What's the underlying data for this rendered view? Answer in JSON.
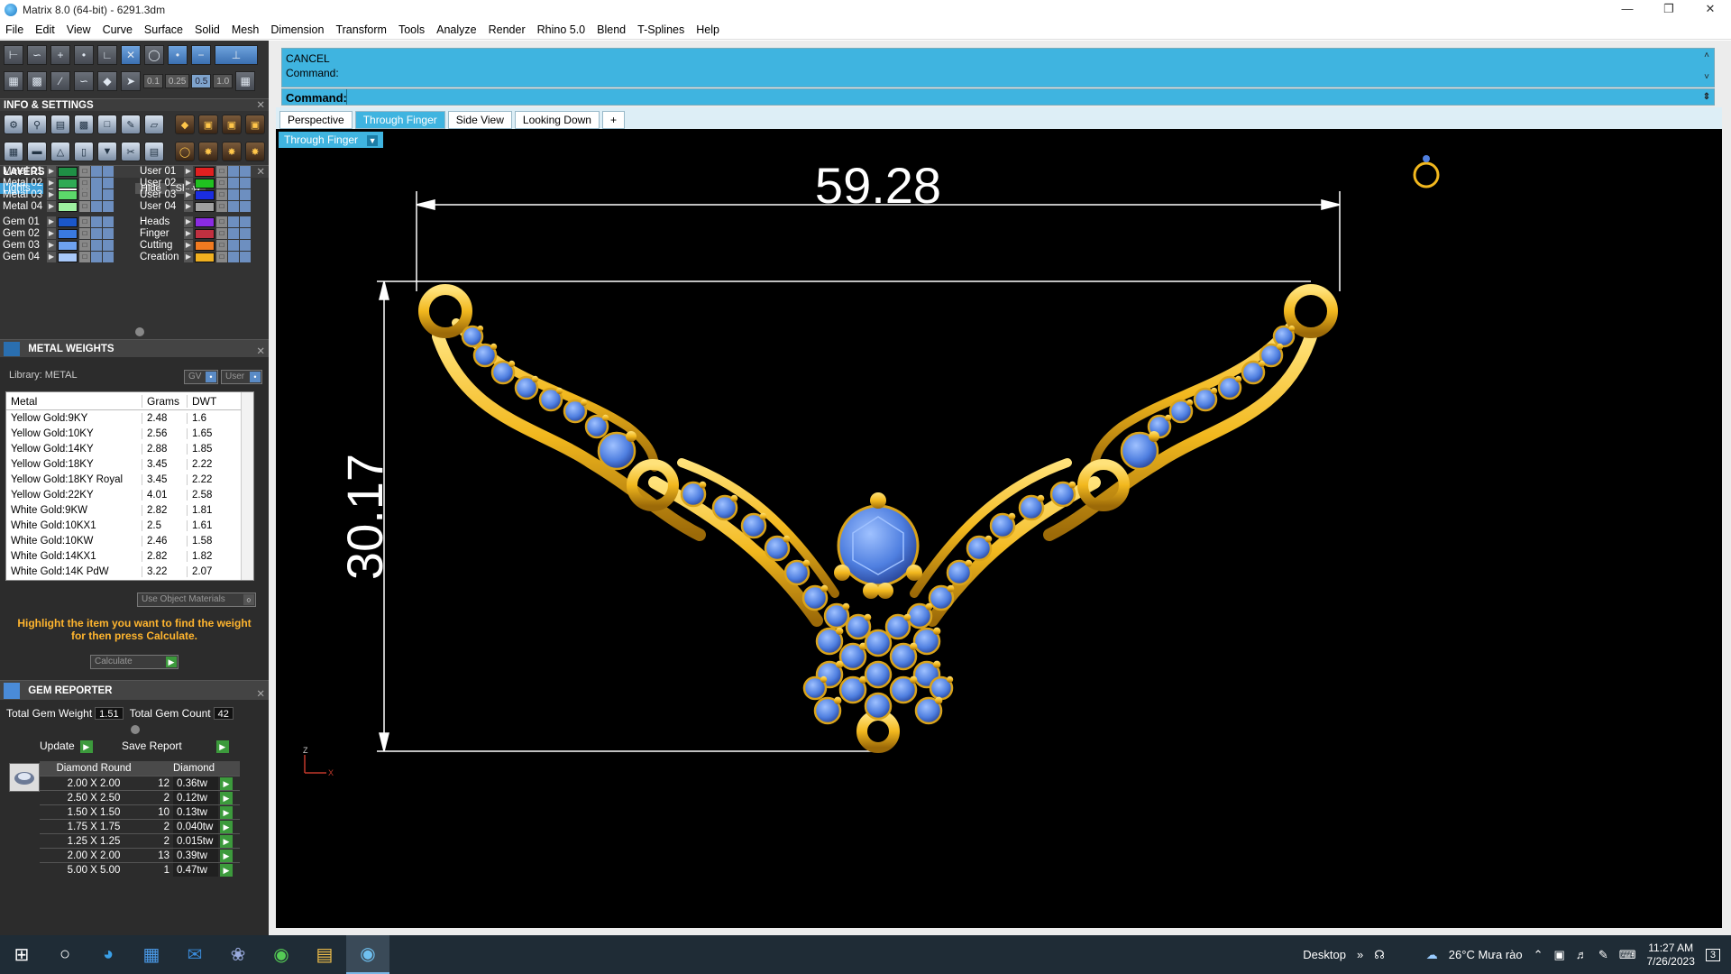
{
  "window": {
    "title": "Matrix 8.0 (64-bit) - 6291.3dm"
  },
  "menu": [
    "File",
    "Edit",
    "View",
    "Curve",
    "Surface",
    "Solid",
    "Mesh",
    "Dimension",
    "Transform",
    "Tools",
    "Analyze",
    "Render",
    "Rhino 5.0",
    "Blend",
    "T-Splines",
    "Help"
  ],
  "snap_values": [
    "0.1",
    "0.25",
    "0.5",
    "1.0"
  ],
  "sections": {
    "info_settings": "INFO & SETTINGS",
    "layers": "LAYERS",
    "metal_weights": "METAL WEIGHTS",
    "gem_reporter": "GEM REPORTER"
  },
  "layers": {
    "lights": "Lights",
    "hide": "Hide",
    "show": "Show",
    "left": [
      {
        "name": "Metal 01",
        "color": "#1f8f45"
      },
      {
        "name": "Metal 02",
        "color": "#2faa55"
      },
      {
        "name": "Metal 03",
        "color": "#5cd86a"
      },
      {
        "name": "Metal 04",
        "color": "#9ef0a0"
      },
      {
        "name": "Gem 01",
        "color": "#1b57c9"
      },
      {
        "name": "Gem 02",
        "color": "#3a7ae0"
      },
      {
        "name": "Gem 03",
        "color": "#6ea2f0"
      },
      {
        "name": "Gem 04",
        "color": "#a8c8f8"
      }
    ],
    "right": [
      {
        "name": "User 01",
        "color": "#e02020"
      },
      {
        "name": "User 02",
        "color": "#20c020"
      },
      {
        "name": "User 03",
        "color": "#1a2de0"
      },
      {
        "name": "User 04",
        "color": "#a0a0a0"
      },
      {
        "name": "Heads",
        "color": "#8a2be2"
      },
      {
        "name": "Finger",
        "color": "#c03040"
      },
      {
        "name": "Cutting",
        "color": "#f07a20"
      },
      {
        "name": "Creation",
        "color": "#f0b020"
      }
    ]
  },
  "metal_weights": {
    "library": "Library: METAL",
    "gv": "GV",
    "user": "User",
    "headers": [
      "Metal",
      "Grams",
      "DWT"
    ],
    "rows": [
      [
        "Yellow Gold:9KY",
        "2.48",
        "1.6"
      ],
      [
        "Yellow Gold:10KY",
        "2.56",
        "1.65"
      ],
      [
        "Yellow Gold:14KY",
        "2.88",
        "1.85"
      ],
      [
        "Yellow Gold:18KY",
        "3.45",
        "2.22"
      ],
      [
        "Yellow Gold:18KY Royal",
        "3.45",
        "2.22"
      ],
      [
        "Yellow Gold:22KY",
        "4.01",
        "2.58"
      ],
      [
        "White Gold:9KW",
        "2.82",
        "1.81"
      ],
      [
        "White Gold:10KX1",
        "2.5",
        "1.61"
      ],
      [
        "White Gold:10KW",
        "2.46",
        "1.58"
      ],
      [
        "White Gold:14KX1",
        "2.82",
        "1.82"
      ],
      [
        "White Gold:14K PdW",
        "3.22",
        "2.07"
      ]
    ],
    "use_object_materials": "Use Object Materials",
    "hint": "Highlight the item you want to find the weight for then press Calculate.",
    "calculate": "Calculate"
  },
  "gem_reporter": {
    "total_weight_label": "Total Gem Weight",
    "total_weight": "1.51",
    "total_count_label": "Total Gem Count",
    "total_count": "42",
    "update": "Update",
    "save_report": "Save Report",
    "headers": [
      "Diamond Round",
      "Diamond"
    ],
    "rows": [
      [
        "2.00 X 2.00",
        "12",
        "0.36tw"
      ],
      [
        "2.50 X 2.50",
        "2",
        "0.12tw"
      ],
      [
        "1.50 X 1.50",
        "10",
        "0.13tw"
      ],
      [
        "1.75 X 1.75",
        "2",
        "0.040tw"
      ],
      [
        "1.25 X 1.25",
        "2",
        "0.015tw"
      ],
      [
        "2.00 X 2.00",
        "13",
        "0.39tw"
      ],
      [
        "5.00 X 5.00",
        "1",
        "0.47tw"
      ]
    ]
  },
  "command": {
    "cancel": "CANCEL",
    "line1": "Command:",
    "prompt": "Command:"
  },
  "tabs": [
    "Perspective",
    "Through Finger",
    "Side View",
    "Looking Down",
    "+"
  ],
  "active_tab": "Through Finger",
  "viewport": {
    "label": "Through Finger",
    "dim_width": "59.28",
    "dim_height": "30.17",
    "axis_z": "Z",
    "axis_x": "X",
    "metal_color": "#f2b81e",
    "gem_color": "#4f7fe0"
  },
  "taskbar": {
    "desktop": "Desktop",
    "weather": "26°C  Mưa rào",
    "time": "11:27 AM",
    "date": "7/26/2023",
    "notif": "3"
  }
}
